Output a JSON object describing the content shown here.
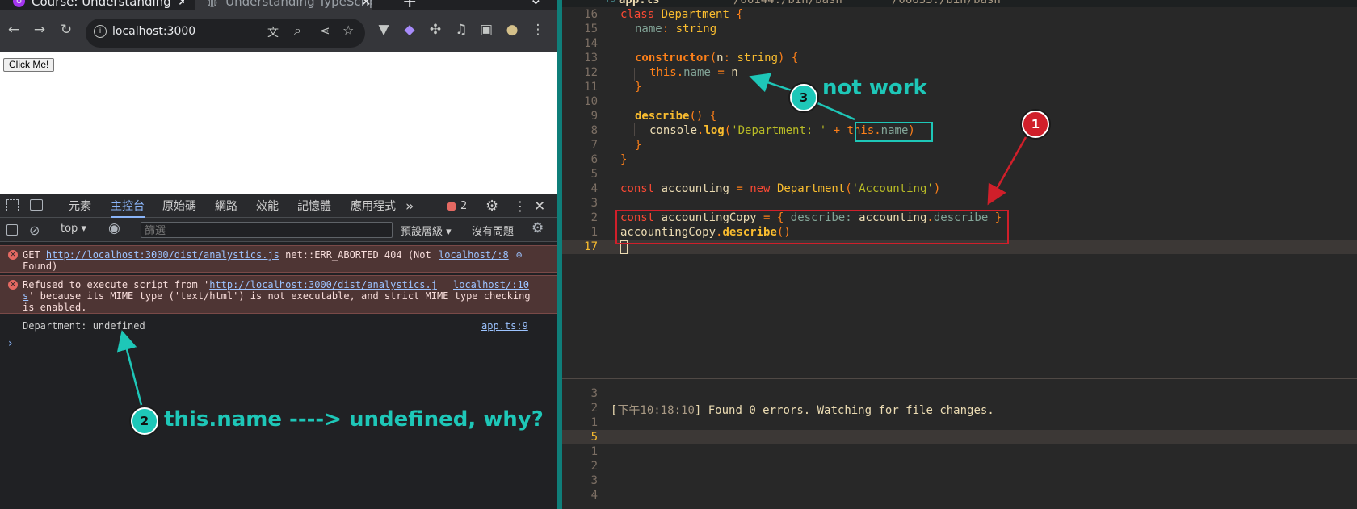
{
  "browser": {
    "tabs": [
      {
        "title": "Course: Understanding",
        "active": false
      },
      {
        "title": "Understanding TypeScrip",
        "active": true
      }
    ],
    "new_tab": "+",
    "chevron": "⌄",
    "address": "localhost:3000",
    "page": {
      "button_label": "Click Me!"
    }
  },
  "devtools": {
    "tabs": [
      "元素",
      "主控台",
      "原始碼",
      "網路",
      "效能",
      "記憶體",
      "應用程式"
    ],
    "active_tab": "主控台",
    "more": "»",
    "error_count": "2",
    "context": "top",
    "filter_placeholder": "篩選",
    "levels": "預設層級",
    "issues": "沒有問題",
    "messages": [
      {
        "type": "error",
        "pre": "GET ",
        "url": "http://localhost:3000/dist/analystics.js",
        "post": " net::ERR_ABORTED 404 (Not",
        "cont": "Found)",
        "source": "localhost/:8"
      },
      {
        "type": "error",
        "pre": "Refused to execute script from '",
        "url": "http://localhost:3000/dist/analystics.j",
        "url2": "s",
        "post2": "' because its MIME type ('text/html') is not executable, and strict MIME type checking",
        "cont": "is enabled.",
        "source": "localhost/:10"
      },
      {
        "type": "log",
        "text": "Department: undefined",
        "source": "app.ts:9"
      }
    ],
    "prompt": "›"
  },
  "editor": {
    "filename": "app.ts",
    "tab2": "/06144:/bin/bash",
    "tab3": "/06633:/bin/bash",
    "line_numbers": [
      "16",
      "15",
      "14",
      "13",
      "12",
      "11",
      "10",
      "9",
      "8",
      "7",
      "6",
      "5",
      "4",
      "3",
      "2",
      "1",
      "17"
    ],
    "code": {
      "l16": {
        "kw": "class",
        "name": "Department",
        "brace": "{"
      },
      "l15": {
        "prop": "name",
        "colon": ":",
        "type": "string"
      },
      "l13": {
        "fn": "constructor",
        "open": "(",
        "param": "n",
        "colon": ":",
        "type": "string",
        "close": ")",
        "brace": "{"
      },
      "l12": {
        "this": "this",
        "dot": ".",
        "prop": "name",
        "eq": "=",
        "val": "n"
      },
      "l11": "}",
      "l9": {
        "fn": "describe",
        "paren": "()",
        "brace": "{"
      },
      "l8": {
        "obj": "console",
        "dot": ".",
        "fn": "log",
        "open": "(",
        "str": "'Department: '",
        "plus": "+",
        "this": "this",
        "dot2": ".",
        "prop": "name",
        "close": ")"
      },
      "l7": "}",
      "l6": "}",
      "l4": {
        "kw": "const",
        "var": "accounting",
        "eq": "=",
        "new": "new",
        "cls": "Department",
        "open": "(",
        "str": "'Accounting'",
        "close": ")"
      },
      "l2": {
        "kw": "const",
        "var": "accountingCopy",
        "eq": "=",
        "open": "{",
        "key": "describe",
        "colon": ":",
        "obj": "accounting",
        "dot": ".",
        "prop": "describe",
        "close": "}"
      },
      "l1": {
        "var": "accountingCopy",
        "dot": ".",
        "fn": "describe",
        "paren": "()"
      }
    }
  },
  "terminal": {
    "line_numbers": [
      "3",
      "2",
      "1",
      "5",
      "1",
      "2",
      "3",
      "4"
    ],
    "output": {
      "open": "[",
      "time": "下午10:18:10",
      "close": "]",
      "msg": " Found 0 errors. Watching for file changes."
    }
  },
  "annotations": {
    "badge1": "1",
    "badge2": "2",
    "badge3": "3",
    "text2": "this.name ----> undefined, why?",
    "text3": "not work"
  },
  "colors": {
    "annotation_teal": "#1ec7b8",
    "annotation_red": "#d01f2a",
    "divider": "#0f7e79"
  }
}
